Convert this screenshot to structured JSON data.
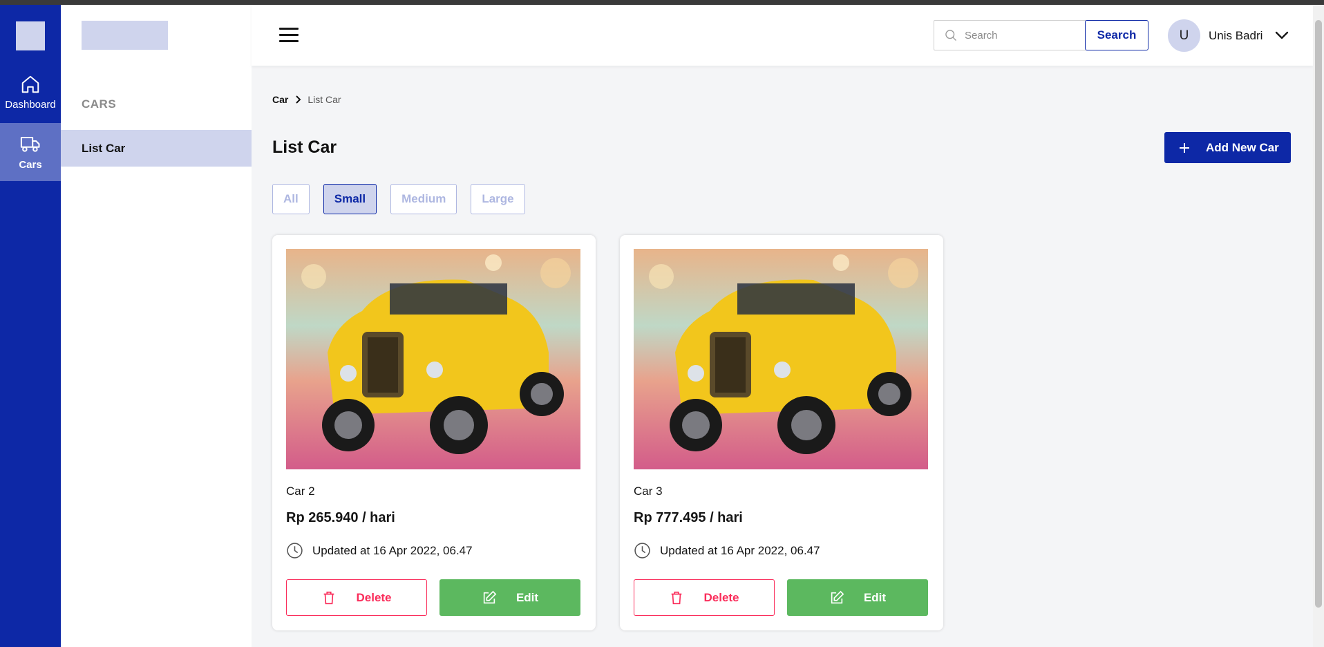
{
  "rail": {
    "items": [
      {
        "label": "Dashboard",
        "icon": "home-icon"
      },
      {
        "label": "Cars",
        "icon": "truck-icon"
      }
    ]
  },
  "sidebar": {
    "section_title": "CARS",
    "items": [
      {
        "label": "List Car"
      }
    ]
  },
  "header": {
    "search": {
      "placeholder": "Search",
      "button_label": "Search"
    },
    "user": {
      "initial": "U",
      "name": "Unis Badri"
    }
  },
  "breadcrumb": {
    "root": "Car",
    "current": "List Car"
  },
  "page": {
    "title": "List Car",
    "add_button_label": "Add New Car",
    "filters": [
      "All",
      "Small",
      "Medium",
      "Large"
    ],
    "active_filter": "Small"
  },
  "cards": [
    {
      "name": "Car 2",
      "price": "Rp 265.940 / hari",
      "updated": "Updated at 16 Apr 2022, 06.47",
      "delete_label": "Delete",
      "edit_label": "Edit"
    },
    {
      "name": "Car 3",
      "price": "Rp 777.495 / hari",
      "updated": "Updated at 16 Apr 2022, 06.47",
      "delete_label": "Delete",
      "edit_label": "Edit"
    }
  ],
  "colors": {
    "primary": "#0D28A6",
    "primary_light": "#CFD4ED",
    "danger": "#FA2C5A",
    "success": "#5CB85F",
    "background": "#F4F5F7"
  }
}
